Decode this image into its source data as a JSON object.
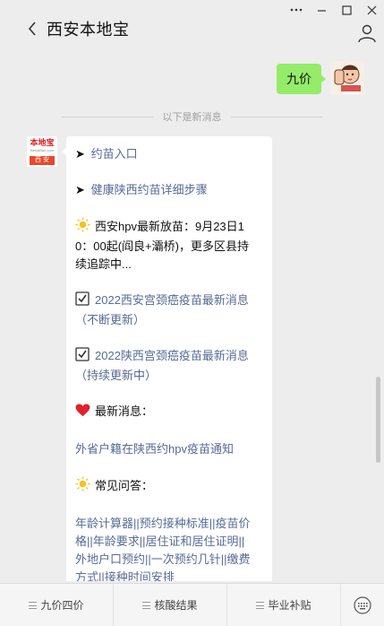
{
  "window": {
    "controls": [
      "more",
      "minimize",
      "maximize",
      "close"
    ]
  },
  "header": {
    "title": "西安本地宝"
  },
  "chat": {
    "my_message": "九价",
    "divider_text": "以下是新消息",
    "bot_avatar": {
      "logo_top": "本地宝",
      "logo_mid": "BendiBao.com",
      "logo_bottom": "西 安"
    },
    "message": {
      "line1": "约苗入口",
      "line2": "健康陕西约苗详细步骤",
      "line3_a": "西安hpv最新放苗：9月23日1",
      "line3_b": "0：00起(阎良+灞桥)，更多区县持",
      "line3_c": "续追踪中...",
      "line4_a": "2022西安宫颈癌疫苗最新消息",
      "line4_b": "（不断更新）",
      "line5_a": "2022陕西宫颈癌疫苗最新消息",
      "line5_b": "（持续更新中）",
      "line6": "最新消息：",
      "line7": "外省户籍在陕西约hpv疫苗通知",
      "line8": "常见问答：",
      "faq_1": "年龄计算器||预约接种标准||疫苗价",
      "faq_2": "格||年龄要求||居住证和居住证明||",
      "faq_3": "外地户口预约||一次预约几针||缴费",
      "faq_4": "方式||接种时间安排"
    }
  },
  "bottom_menu": {
    "items": [
      "九价四价",
      "核酸结果",
      "毕业补贴"
    ]
  },
  "colors": {
    "background": "#ededed",
    "my_bubble": "#95ec69",
    "link": "#576b95"
  }
}
